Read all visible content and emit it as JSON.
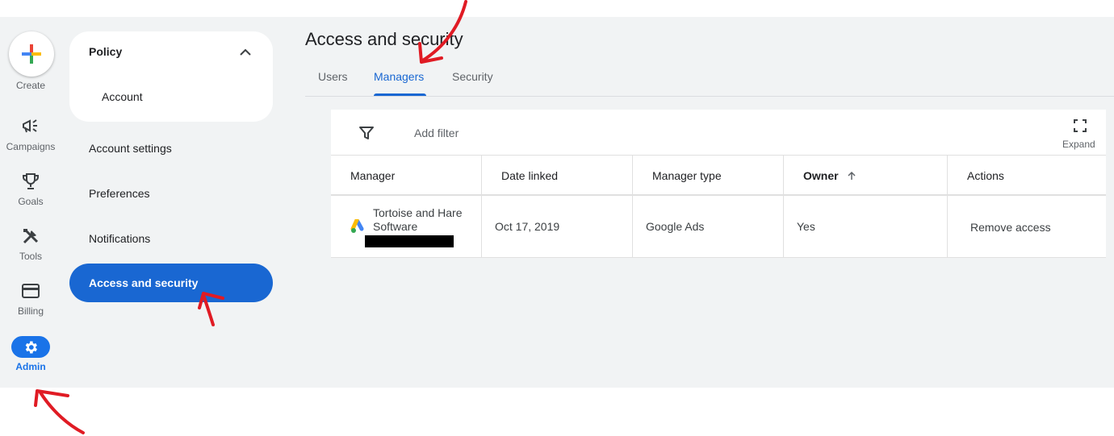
{
  "rail": {
    "create_label": "Create",
    "items": [
      {
        "label": "Campaigns",
        "icon": "campaigns-icon"
      },
      {
        "label": "Goals",
        "icon": "trophy-icon"
      },
      {
        "label": "Tools",
        "icon": "tools-icon"
      },
      {
        "label": "Billing",
        "icon": "credit-card-icon"
      },
      {
        "label": "Admin",
        "icon": "gear-icon"
      }
    ]
  },
  "nav": {
    "policy_label": "Policy",
    "policy_sub": "Account",
    "items": [
      "Account settings",
      "Preferences",
      "Notifications"
    ],
    "active": "Access and security"
  },
  "page": {
    "title": "Access and security",
    "tabs": [
      "Users",
      "Managers",
      "Security"
    ],
    "active_tab": "Managers"
  },
  "table": {
    "add_filter": "Add filter",
    "expand": "Expand",
    "columns": [
      "Manager",
      "Date linked",
      "Manager type",
      "Owner",
      "Actions"
    ],
    "rows": [
      {
        "manager": "Tortoise and Hare Software",
        "date_linked": "Oct 17, 2019",
        "manager_type": "Google Ads",
        "owner": "Yes",
        "action": "Remove access"
      }
    ]
  },
  "colors": {
    "accent": "#1967d2",
    "background": "#f1f3f4",
    "annotation": "#e01b24"
  }
}
